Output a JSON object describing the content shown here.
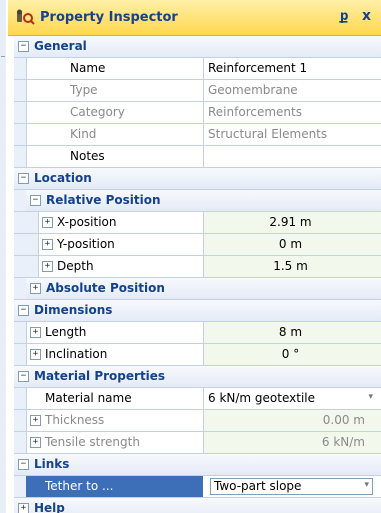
{
  "window": {
    "title": "Property Inspector",
    "pin_glyph": "ք",
    "close_glyph": "x"
  },
  "icons": {
    "title": "wrench-search-icon",
    "pin": "pin-icon",
    "close": "close-icon"
  },
  "colors": {
    "title_bar": "#ffd64d",
    "category_text": "#15428b",
    "value_tint": "#f2f8ec",
    "selection": "#3d6fb8"
  },
  "toggle": {
    "minus": "−",
    "plus": "+"
  },
  "sections": {
    "general": {
      "label": "General",
      "name": {
        "label": "Name",
        "value": "Reinforcement 1"
      },
      "type": {
        "label": "Type",
        "value": "Geomembrane"
      },
      "category": {
        "label": "Category",
        "value": "Reinforcements"
      },
      "kind": {
        "label": "Kind",
        "value": "Structural Elements"
      },
      "notes": {
        "label": "Notes",
        "value": ""
      }
    },
    "location": {
      "label": "Location",
      "relative": {
        "label": "Relative Position",
        "x": {
          "label": "X-position",
          "value": "2.91 m"
        },
        "y": {
          "label": "Y-position",
          "value": "0 m"
        },
        "depth": {
          "label": "Depth",
          "value": "1.5 m"
        }
      },
      "absolute": {
        "label": "Absolute Position"
      }
    },
    "dimensions": {
      "label": "Dimensions",
      "length": {
        "label": "Length",
        "value": "8 m"
      },
      "inclination": {
        "label": "Inclination",
        "value": "0 °"
      }
    },
    "material": {
      "label": "Material Properties",
      "material_name": {
        "label": "Material name",
        "value": "6 kN/m geotextile"
      },
      "thickness": {
        "label": "Thickness",
        "value": "0.00 m"
      },
      "tensile": {
        "label": "Tensile strength",
        "value": "6 kN/m"
      }
    },
    "links": {
      "label": "Links",
      "tether": {
        "label": "Tether to ...",
        "value": "Two-part slope"
      }
    },
    "help": {
      "label": "Help"
    }
  },
  "dropdown_glyph": "▾"
}
